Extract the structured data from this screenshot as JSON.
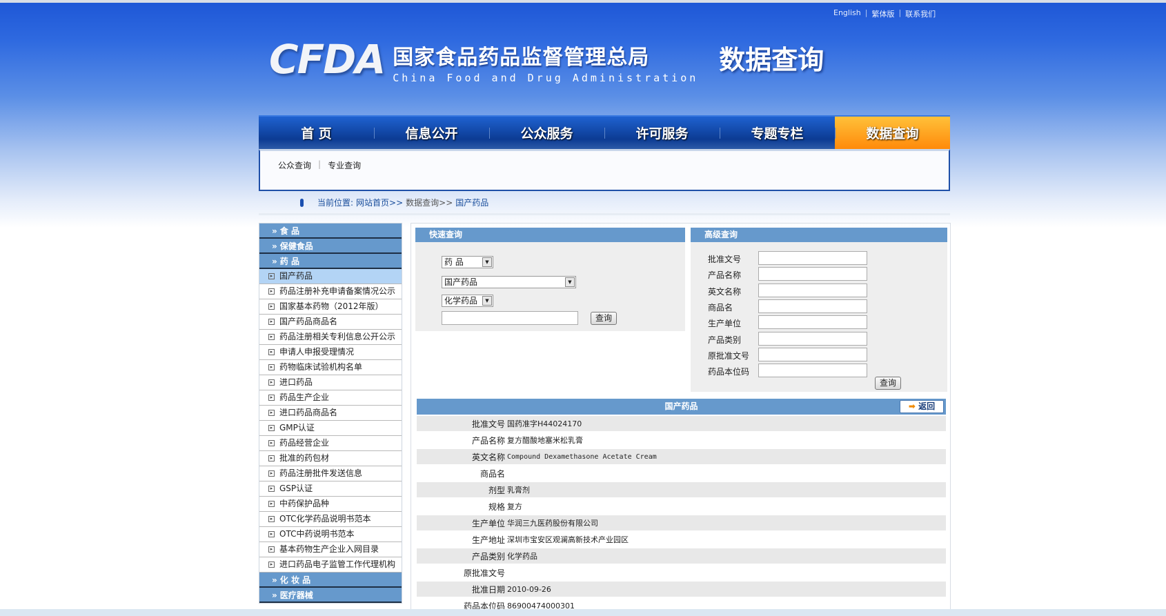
{
  "top_links": [
    "English",
    "繁体版",
    "联系我们"
  ],
  "logo": {
    "mark": "CFDA",
    "cn": "国家食品药品监督管理总局",
    "en": "China Food and Drug Administration",
    "sub": "数据查询"
  },
  "nav": [
    "首  页",
    "信息公开",
    "公众服务",
    "许可服务",
    "专题专栏",
    "数据查询"
  ],
  "subnav": [
    "公众查询",
    "专业查询"
  ],
  "breadcrumb": {
    "label": "当前位置:",
    "home": "网站首页>>",
    "section": "数据查询>>",
    "current": "国产药品"
  },
  "sidebar": {
    "heads_top": [
      "食    品",
      "保健食品",
      "药    品"
    ],
    "items": [
      "国产药品",
      "药品注册补充申请备案情况公示",
      "国家基本药物（2012年版）",
      "国产药品商品名",
      "药品注册相关专利信息公开公示",
      "申请人申报受理情况",
      "药物临床试验机构名单",
      "进口药品",
      "药品生产企业",
      "进口药品商品名",
      "GMP认证",
      "药品经营企业",
      "批准的药包材",
      "药品注册批件发送信息",
      "GSP认证",
      "中药保护品种",
      "OTC化学药品说明书范本",
      "OTC中药说明书范本",
      "基本药物生产企业入网目录",
      "进口药品电子监管工作代理机构"
    ],
    "heads_bottom": [
      "化 妆 品",
      "医疗器械"
    ]
  },
  "quick": {
    "title": "快速查询",
    "select1": "药    品",
    "select2": "国产药品",
    "select3": "化学药品",
    "input": "",
    "button": "查询"
  },
  "advanced": {
    "title": "高级查询",
    "fields": [
      "批准文号",
      "产品名称",
      "英文名称",
      "商品名",
      "生产单位",
      "产品类别",
      "原批准文号",
      "药品本位码"
    ],
    "button": "查询"
  },
  "detail": {
    "title": "国产药品",
    "back": "返回",
    "rows": [
      {
        "k": "批准文号",
        "v": "国药准字H44024170"
      },
      {
        "k": "产品名称",
        "v": "复方醋酸地塞米松乳膏"
      },
      {
        "k": "英文名称",
        "v": "Compound Dexamethasone Acetate Cream"
      },
      {
        "k": "商品名",
        "v": ""
      },
      {
        "k": "剂型",
        "v": "乳膏剂"
      },
      {
        "k": "规格",
        "v": "复方"
      },
      {
        "k": "生产单位",
        "v": "华润三九医药股份有限公司"
      },
      {
        "k": "生产地址",
        "v": "深圳市宝安区观澜高新技术产业园区"
      },
      {
        "k": "产品类别",
        "v": "化学药品"
      },
      {
        "k": "原批准文号",
        "v": ""
      },
      {
        "k": "批准日期",
        "v": "2010-09-26"
      },
      {
        "k": "药品本位码",
        "v": "86900474000301"
      }
    ]
  }
}
